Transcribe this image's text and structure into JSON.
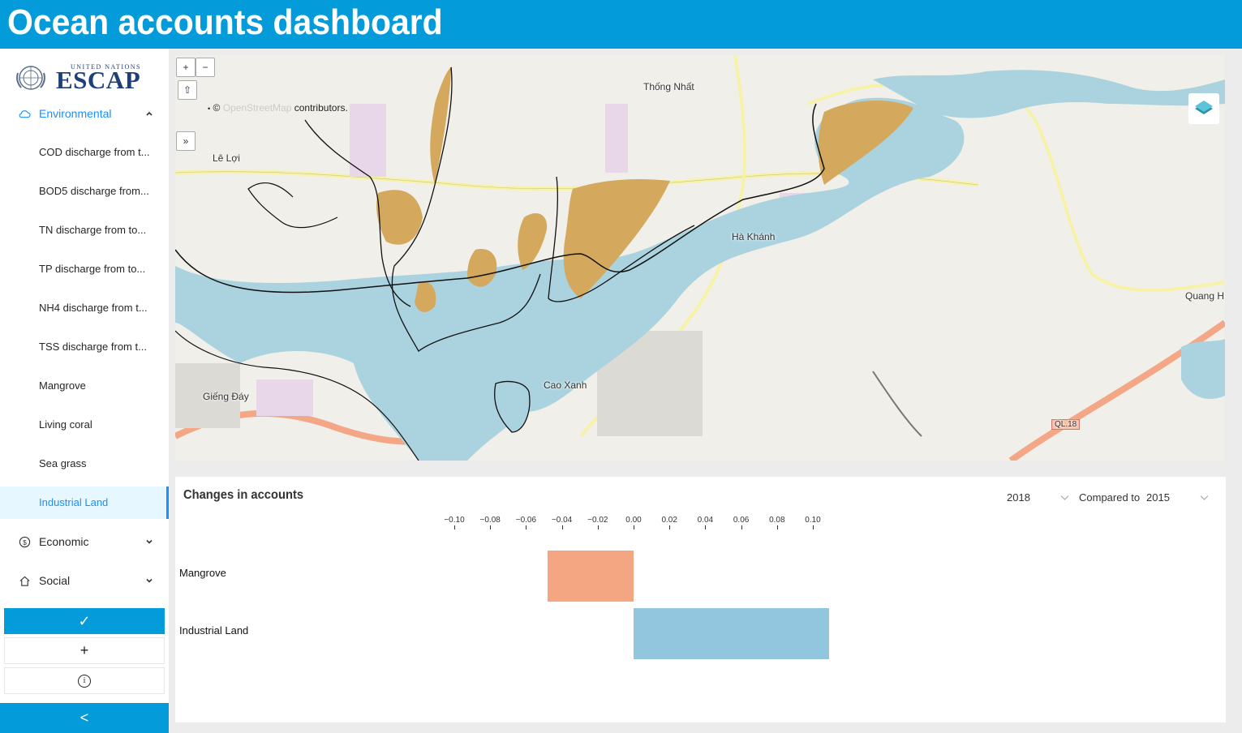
{
  "header": {
    "title": "Ocean accounts dashboard"
  },
  "logo": {
    "line1": "UNITED NATIONS",
    "line2": "ESCAP"
  },
  "sidebar": {
    "environmental": {
      "label": "Environmental",
      "icon": "cloud-icon"
    },
    "items": [
      {
        "label": "COD discharge from t..."
      },
      {
        "label": "BOD5 discharge from..."
      },
      {
        "label": "TN discharge from to..."
      },
      {
        "label": "TP discharge from to..."
      },
      {
        "label": "NH4 discharge from t..."
      },
      {
        "label": "TSS discharge from t..."
      },
      {
        "label": "Mangrove"
      },
      {
        "label": "Living coral"
      },
      {
        "label": "Sea grass"
      },
      {
        "label": "Industrial Land"
      }
    ],
    "selected_item": "Industrial Land",
    "economic": {
      "label": "Economic",
      "icon": "dollar-circle-icon"
    },
    "social": {
      "label": "Social",
      "icon": "home-icon"
    },
    "buttons": {
      "confirm": "✓",
      "add": "+",
      "info": "i"
    },
    "collapse": "<"
  },
  "map": {
    "zoom_in": "+",
    "zoom_out": "−",
    "home": "⇧",
    "expand": "»",
    "attribution_prefix": "©",
    "attribution_link": "OpenStreetMap",
    "attribution_suffix": "contributors.",
    "places": {
      "thong_nhat": "Thống Nhất",
      "le_loi": "Lê Lợi",
      "ha_khanh": "Hà Khánh",
      "cao_xanh": "Cao Xanh",
      "gieng_day": "Giếng Đáy",
      "quang": "Quang H",
      "ql18": "QL.18"
    },
    "colors": {
      "water": "#aad3df",
      "land": "#f1efe9",
      "mangrove": "#d4a95e",
      "boundary": "#111111"
    }
  },
  "panel": {
    "title": "Changes in accounts",
    "year": "2018",
    "compared_label": "Compared to",
    "compared_year": "2015"
  },
  "chart_data": {
    "type": "bar",
    "orientation": "horizontal",
    "categories": [
      "Mangrove",
      "Industrial Land"
    ],
    "values": [
      -0.048,
      0.109
    ],
    "colors": [
      "#f4a582",
      "#92c5de"
    ],
    "xlim": [
      -0.11,
      0.11
    ],
    "xticks": [
      "−0.10",
      "−0.08",
      "−0.06",
      "−0.04",
      "−0.02",
      "0.00",
      "0.02",
      "0.04",
      "0.06",
      "0.08",
      "0.10"
    ],
    "xtick_values": [
      -0.1,
      -0.08,
      -0.06,
      -0.04,
      -0.02,
      0.0,
      0.02,
      0.04,
      0.06,
      0.08,
      0.1
    ],
    "title": "",
    "xlabel": "",
    "ylabel": "",
    "grid": false,
    "axis_position": "top"
  }
}
